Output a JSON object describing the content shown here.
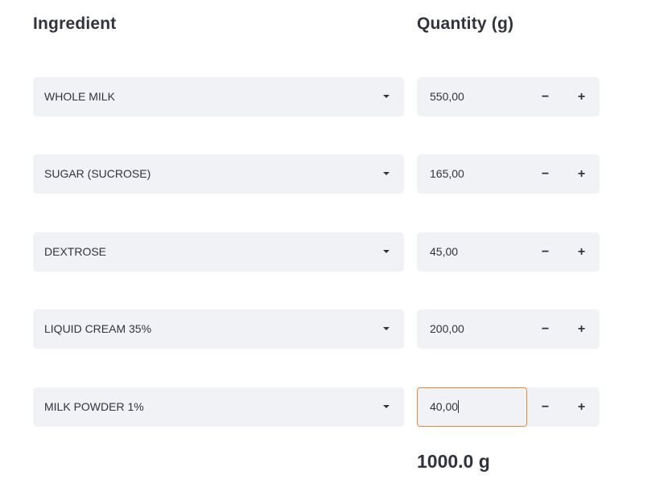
{
  "headers": {
    "ingredient": "Ingredient",
    "quantity": "Quantity (g)"
  },
  "rows": [
    {
      "ingredient": "WHOLE MILK",
      "quantity": "550,00"
    },
    {
      "ingredient": "SUGAR (SUCROSE)",
      "quantity": "165,00"
    },
    {
      "ingredient": "DEXTROSE",
      "quantity": "45,00"
    },
    {
      "ingredient": "LIQUID CREAM 35%",
      "quantity": "200,00"
    },
    {
      "ingredient": "MILK POWDER 1%",
      "quantity": "40,00"
    }
  ],
  "stepper": {
    "minus_label": "−",
    "plus_label": "+"
  },
  "total": "1000.0 g",
  "colors": {
    "field_bg": "#f0f2f6",
    "focus_border": "#e6883a",
    "text": "#31333f"
  },
  "icons": {
    "dropdown": "caret-down-icon"
  }
}
